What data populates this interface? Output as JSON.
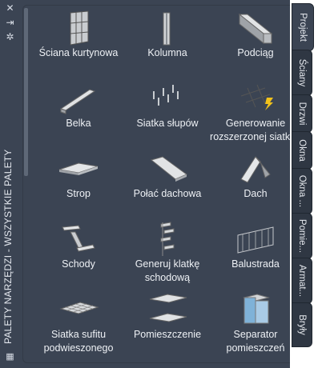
{
  "palette_title": "PALETY NARZĘDZI - WSZYSTKIE PALETY",
  "tabs": [
    "Projekt",
    "Ściany",
    "Drzwi",
    "Okna",
    "Okna ...",
    "Pomie...",
    "Armat...",
    "Bryły"
  ],
  "active_tab": "Projekt",
  "tools": [
    {
      "label": "Ściana kurtynowa",
      "icon": "curtain-wall-icon"
    },
    {
      "label": "Kolumna",
      "icon": "column-icon"
    },
    {
      "label": "Podciąg",
      "icon": "beam-girder-icon"
    },
    {
      "label": "Belka",
      "icon": "beam-icon"
    },
    {
      "label": "Siatka słupów",
      "icon": "column-grid-icon"
    },
    {
      "label": "Generowanie rozszerzonej siatk ...",
      "icon": "enhanced-grid-icon"
    },
    {
      "label": "Strop",
      "icon": "slab-icon"
    },
    {
      "label": "Połać dachowa",
      "icon": "roof-slab-icon"
    },
    {
      "label": "Dach",
      "icon": "roof-icon"
    },
    {
      "label": "Schody",
      "icon": "stair-icon"
    },
    {
      "label": "Generuj klatkę schodową",
      "icon": "stair-tower-icon"
    },
    {
      "label": "Balustrada",
      "icon": "railing-icon"
    },
    {
      "label": "Siatka sufitu podwieszonego",
      "icon": "ceiling-grid-icon"
    },
    {
      "label": "Pomieszczenie",
      "icon": "space-icon"
    },
    {
      "label": "Separator pomieszczeń",
      "icon": "space-separator-icon"
    }
  ]
}
